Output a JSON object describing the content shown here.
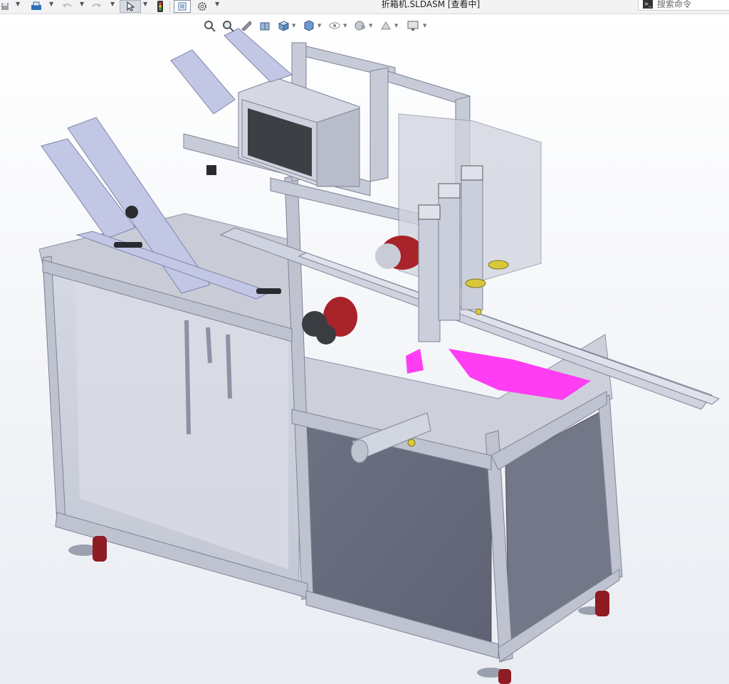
{
  "window": {
    "title": "折箱机.SLDASM [查看中]"
  },
  "search": {
    "placeholder": "搜索命令",
    "icon": "terminal-icon"
  },
  "toolbar": {
    "icons": [
      "save-icon",
      "print-icon",
      "undo-icon",
      "redo-icon",
      "select-pointer-icon",
      "traffic-light-icon",
      "file-properties-icon",
      "options-gear-icon"
    ]
  },
  "view_toolbar": {
    "icons": [
      "zoom-to-fit-icon",
      "zoom-to-area-icon",
      "previous-view-icon",
      "section-view-icon",
      "view-orientation-icon",
      "display-style-icon",
      "hide-show-items-icon",
      "edit-appearance-icon",
      "apply-scene-icon",
      "view-settings-icon"
    ]
  },
  "colors": {
    "frame": "#c4c8d6",
    "frame_dark": "#8c91a6",
    "panel": "#6b6f80",
    "glass": "#d7dbe6",
    "accent_magenta": "#ff3df2",
    "motor_red": "#a8232a",
    "caster_red": "#8e1c22",
    "brass": "#d8c83c"
  }
}
